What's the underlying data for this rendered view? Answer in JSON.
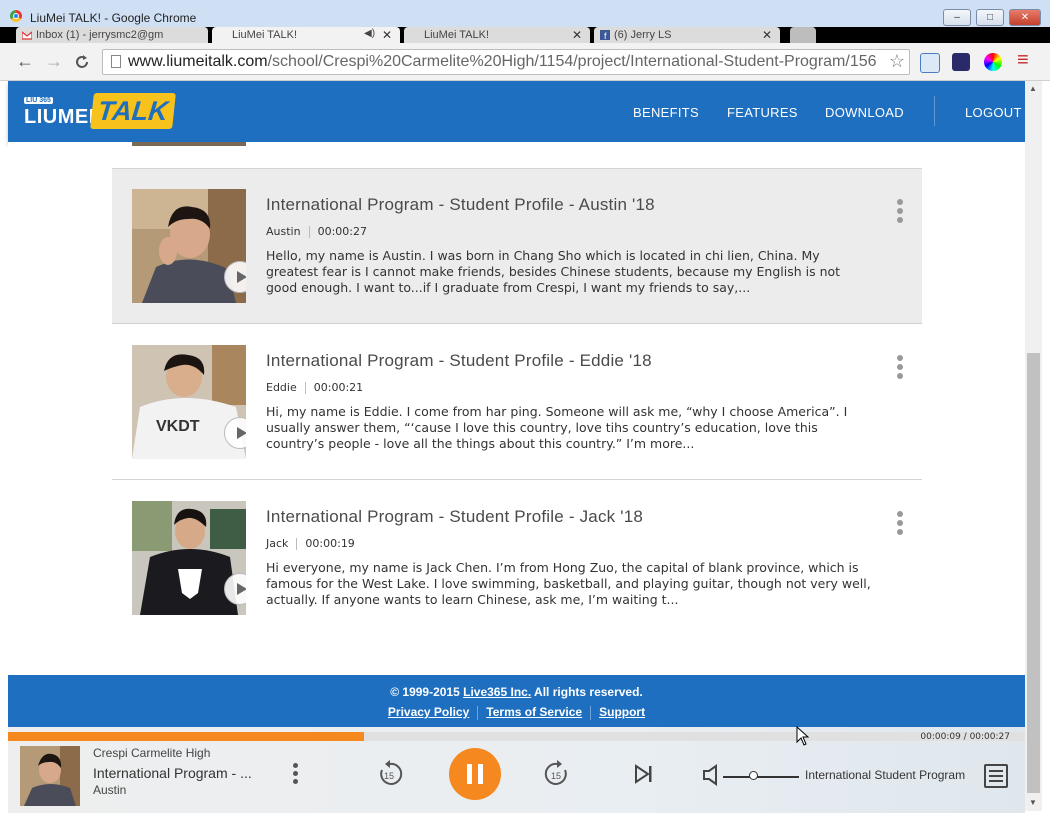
{
  "window": {
    "title": "LiuMei TALK! - Google Chrome",
    "minimize": "–",
    "maximize": "□",
    "close": "✕"
  },
  "tabs": [
    {
      "label": "Inbox (1) - jerrysmc2@gm",
      "close": "✕"
    },
    {
      "label": "LiuMei TALK!",
      "close": "✕"
    },
    {
      "label": "LiuMei TALK!",
      "close": "✕"
    },
    {
      "label": "(6) Jerry LS",
      "close": "✕"
    }
  ],
  "toolbar": {
    "back": "←",
    "forward": "→",
    "url_host": "www.liumeitalk.com",
    "url_path": "/school/Crespi%20Carmelite%20High/1154/project/International-Student-Program/156",
    "star": "☆",
    "menu": "≡"
  },
  "site": {
    "logo_badge": "LIU 365",
    "logo_liumei": "LIUMEI",
    "logo_talk": "TALK",
    "nav": [
      "BENEFITS",
      "FEATURES",
      "DOWNLOAD",
      "LOGOUT"
    ]
  },
  "profiles": [
    {
      "title": "International Program - Student Profile - Austin '18",
      "author": "Austin",
      "duration": "00:00:27",
      "description": "Hello, my name is Austin.  I was born in Chang Sho which is located in chi lien, China.  My greatest fear is I cannot make friends, besides Chinese students, because my English is not good enough.  I want to...if I graduate from Crespi, I want my friends to say,..."
    },
    {
      "title": "International Program - Student Profile - Eddie '18",
      "author": "Eddie",
      "duration": "00:00:21",
      "description": "Hi, my name is Eddie.  I come from har ping.  Someone will ask me, “why I choose America”.  I usually answer them, “‘cause I love this country, love tihs country’s education, love this country’s people - love all the things about this country.”  I’m more..."
    },
    {
      "title": "International Program - Student Profile - Jack '18",
      "author": "Jack",
      "duration": "00:00:19",
      "description": "Hi everyone, my name is Jack Chen.  I’m from Hong Zuo, the capital of blank province, which is famous for the West Lake.  I love swimming, basketball, and playing guitar, though not very well, actually.  If anyone wants to learn Chinese, ask me, I’m waiting t..."
    }
  ],
  "footer": {
    "copyright_prefix": "© 1999-2015 ",
    "company": "Live365 Inc.",
    "copyright_suffix": " All rights reserved.",
    "links": [
      "Privacy Policy",
      "Terms of Service",
      "Support"
    ]
  },
  "player": {
    "school": "Crespi Carmelite High",
    "title": "International Program - ...",
    "author": "Austin",
    "time": "00:00:09 / 00:00:27",
    "progress_fraction": 0.35,
    "volume_fraction": 0.4,
    "playlist": "International Student Program"
  },
  "colors": {
    "brand_blue": "#1f6fc0",
    "brand_yellow": "#f7c21c",
    "accent_orange": "#f5881f"
  }
}
